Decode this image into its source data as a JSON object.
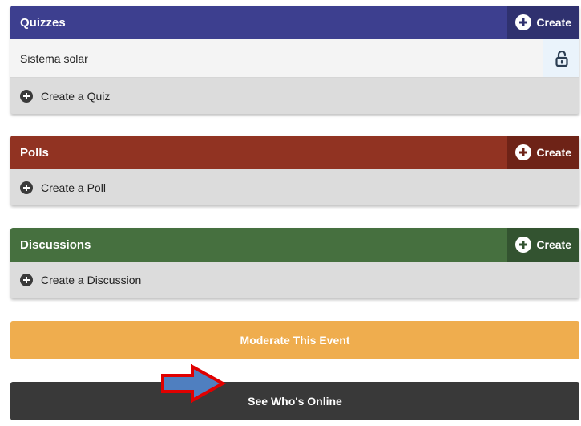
{
  "quizzes": {
    "title": "Quizzes",
    "create_label": "Create",
    "items": [
      {
        "label": "Sistema solar",
        "icon": "unlock-icon"
      }
    ],
    "add_label": "Create a Quiz"
  },
  "polls": {
    "title": "Polls",
    "create_label": "Create",
    "add_label": "Create a Poll"
  },
  "discussions": {
    "title": "Discussions",
    "create_label": "Create",
    "add_label": "Create a Discussion"
  },
  "actions": {
    "moderate_label": "Moderate This Event",
    "online_label": "See Who's Online"
  },
  "colors": {
    "quizzes_header": "#3d3f8f",
    "polls_header": "#913322",
    "discussions_header": "#46703f",
    "moderate": "#efad4e",
    "online": "#393939",
    "annotation_arrow_fill": "#4f7fc0",
    "annotation_arrow_stroke": "#e00000"
  }
}
